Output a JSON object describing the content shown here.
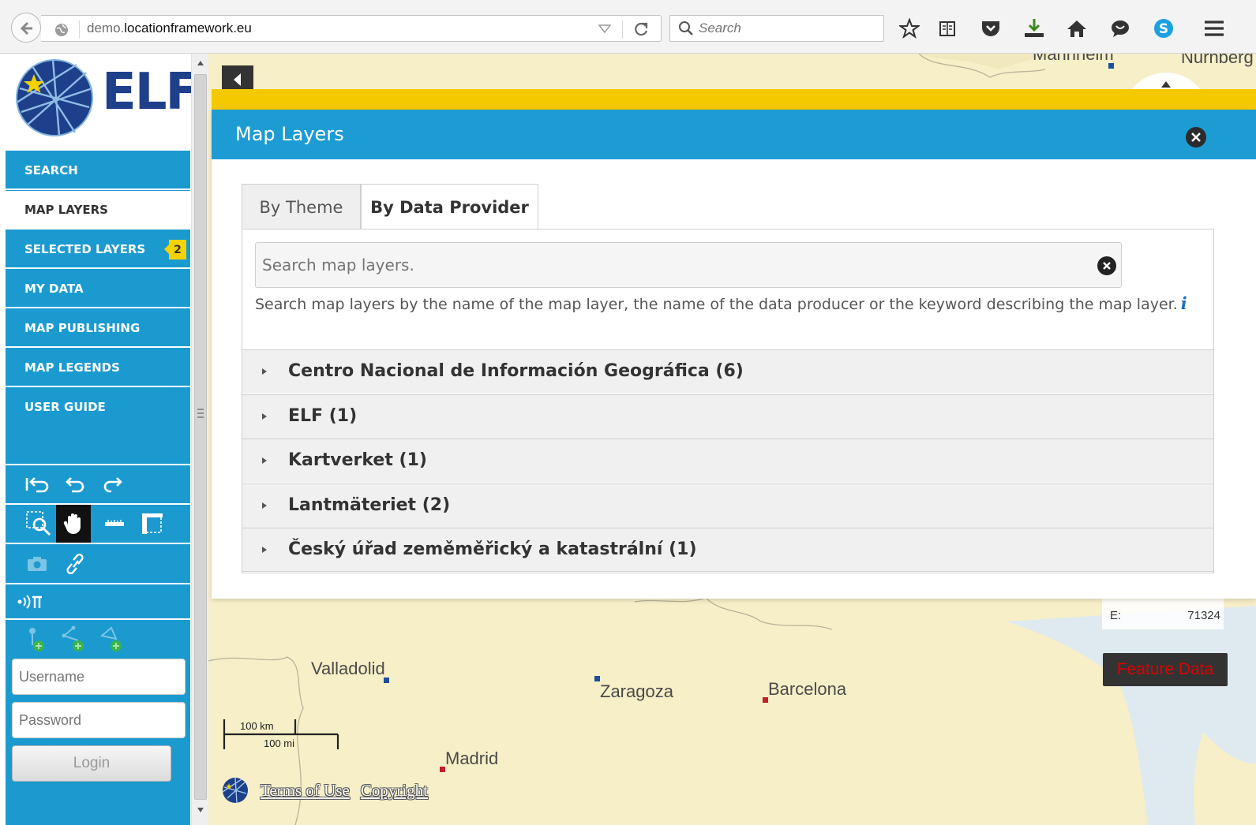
{
  "browser": {
    "url_prefix": "demo.",
    "url_domain": "locationframework.eu",
    "search_placeholder": "Search"
  },
  "sidebar": {
    "logo_text": "ELF",
    "menu": [
      {
        "label": "SEARCH"
      },
      {
        "label": "MAP LAYERS",
        "active": true
      },
      {
        "label": "SELECTED LAYERS",
        "badge": "2"
      },
      {
        "label": "MY DATA"
      },
      {
        "label": "MAP PUBLISHING"
      },
      {
        "label": "MAP LEGENDS"
      },
      {
        "label": "USER GUIDE"
      }
    ],
    "login": {
      "username_placeholder": "Username",
      "password_placeholder": "Password",
      "button_label": "Login"
    }
  },
  "panel": {
    "title": "Map Layers",
    "tabs": [
      {
        "label": "By Theme",
        "selected": false
      },
      {
        "label": "By Data Provider",
        "selected": true
      }
    ],
    "search_placeholder": "Search map layers.",
    "help_text": "Search map layers by the name of the map layer, the name of the data producer or the keyword describing the map layer.",
    "providers": [
      {
        "label": "Centro Nacional de Información Geográfica (6)"
      },
      {
        "label": "ELF (1)"
      },
      {
        "label": "Kartverket (1)"
      },
      {
        "label": "Lantmäteriet (2)"
      },
      {
        "label": "Český úřad zeměměřický a katastrální (1)"
      }
    ]
  },
  "map": {
    "cities": [
      "Valladolid",
      "Zaragoza",
      "Barcelona",
      "Madrid",
      "Mannheim",
      "Nurnberg"
    ],
    "scale": {
      "km": "100 km",
      "mi": "100 mi"
    },
    "coordinates": {
      "e_label": "E:",
      "e_value": "71324"
    },
    "feature_data_label": "Feature Data",
    "footer": {
      "terms": "Terms of Use",
      "copyright": "Copyright"
    },
    "colors": {
      "land": "#f6efc7",
      "sea": "#dfeaf0",
      "city_dot_red": "#c0202a",
      "city_dot_blue": "#1b4f9c"
    }
  },
  "colors": {
    "accent": "#1b9ad0",
    "panel_header": "#1d9cd4",
    "highlight": "#f4c900",
    "badge": "#f3d200"
  }
}
